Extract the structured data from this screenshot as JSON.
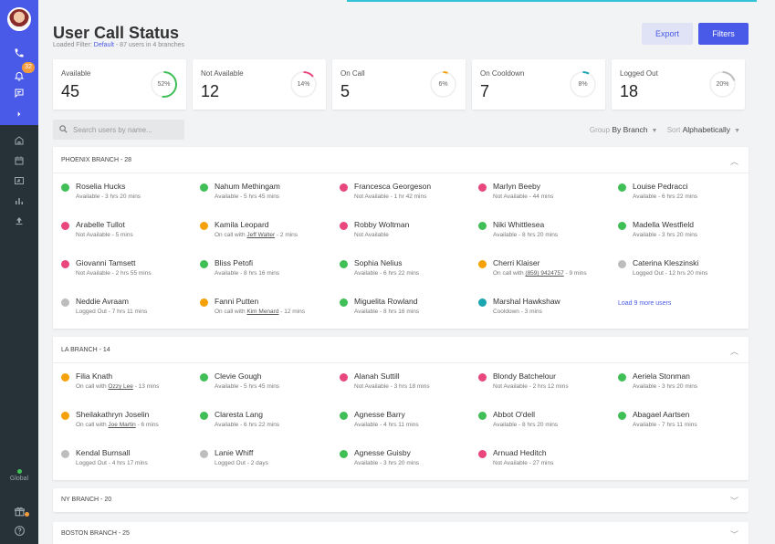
{
  "colors": {
    "available": "#3fbf55",
    "not_available": "#e8467c",
    "on_call": "#f5a10a",
    "cooldown": "#1aa6b0",
    "logged_out": "#bdbdbd",
    "accent": "#4a5ae8",
    "sidebar": "#263238"
  },
  "sidebar": {
    "icons": [
      "avatar",
      "phone-icon",
      "bell-icon",
      "chat-icon",
      "chevron-right-icon",
      "home-icon",
      "calendar-icon",
      "contact-card-icon",
      "bar-chart-icon",
      "upload-icon",
      "gift-icon",
      "help-icon"
    ],
    "notification_count": "32",
    "global_label": "Global"
  },
  "header": {
    "title": "User Call Status",
    "loaded_filter_label": "Loaded Filter:",
    "loaded_filter_value": "Default",
    "loaded_filter_summary": "- 87 users in 4 branches",
    "export_label": "Export",
    "filters_label": "Filters"
  },
  "stats": [
    {
      "label": "Available",
      "value": "45",
      "percent": 52,
      "percent_label": "52%",
      "color": "#3fbf55"
    },
    {
      "label": "Not Available",
      "value": "12",
      "percent": 14,
      "percent_label": "14%",
      "color": "#e8467c"
    },
    {
      "label": "On Call",
      "value": "5",
      "percent": 6,
      "percent_label": "6%",
      "color": "#f5a10a"
    },
    {
      "label": "On Cooldown",
      "value": "7",
      "percent": 8,
      "percent_label": "8%",
      "color": "#1aa6b0"
    },
    {
      "label": "Logged Out",
      "value": "18",
      "percent": 20,
      "percent_label": "20%",
      "color": "#bdbdbd"
    }
  ],
  "toolbar": {
    "search_placeholder": "Search users by name...",
    "group_label": "Group",
    "group_value": "By Branch",
    "sort_label": "Sort",
    "sort_value": "Alphabetically"
  },
  "branches": [
    {
      "title": "PHOENIX BRANCH - 28",
      "expanded": true,
      "load_more": "Load 9 more users",
      "users": [
        {
          "name": "Roselia Hucks",
          "status": "available",
          "pre": "Available - 3 hrs 20 mins",
          "link": "",
          "post": ""
        },
        {
          "name": "Nahum Methingam",
          "status": "available",
          "pre": "Available - 5 hrs 45 mins",
          "link": "",
          "post": ""
        },
        {
          "name": "Francesca Georgeson",
          "status": "not_available",
          "pre": "Not Available - 1 hr 42 mins",
          "link": "",
          "post": ""
        },
        {
          "name": "Marlyn Beeby",
          "status": "not_available",
          "pre": "Not Available - 44 mins",
          "link": "",
          "post": ""
        },
        {
          "name": "Louise Pedracci",
          "status": "available",
          "pre": "Available - 6 hrs 22 mins",
          "link": "",
          "post": ""
        },
        {
          "name": "Arabelle Tullot",
          "status": "not_available",
          "pre": "Not Available - 5 mins",
          "link": "",
          "post": ""
        },
        {
          "name": "Kamila Leopard",
          "status": "on_call",
          "pre": "On call with ",
          "link": "Jeff Walter",
          "post": " - 2 mins"
        },
        {
          "name": "Robby Woltman",
          "status": "not_available",
          "pre": "Not Available",
          "link": "",
          "post": ""
        },
        {
          "name": "Niki Whittlesea",
          "status": "available",
          "pre": "Available - 8 hrs 20 mins",
          "link": "",
          "post": ""
        },
        {
          "name": "Madella Westfield",
          "status": "available",
          "pre": "Available - 3 hrs 20 mins",
          "link": "",
          "post": ""
        },
        {
          "name": "Giovanni Tamsett",
          "status": "not_available",
          "pre": "Not Available - 2 hrs 55 mins",
          "link": "",
          "post": ""
        },
        {
          "name": "Bliss Petofi",
          "status": "available",
          "pre": "Available - 8 hrs 16 mins",
          "link": "",
          "post": ""
        },
        {
          "name": "Sophia Nelius",
          "status": "available",
          "pre": "Available - 6 hrs 22 mins",
          "link": "",
          "post": ""
        },
        {
          "name": "Cherri Klaiser",
          "status": "on_call",
          "pre": "On call with ",
          "link": "(859) 9424757",
          "post": " - 9 mins"
        },
        {
          "name": "Caterina Kleszinski",
          "status": "logged_out",
          "pre": "Logged Out - 12 hrs 20 mins",
          "link": "",
          "post": ""
        },
        {
          "name": "Neddie Avraam",
          "status": "logged_out",
          "pre": "Logged Out - 7 hrs 11 mins",
          "link": "",
          "post": ""
        },
        {
          "name": "Fanni Putten",
          "status": "on_call",
          "pre": "On call with ",
          "link": "Kim Menard",
          "post": " - 12 mins"
        },
        {
          "name": "Miguelita Rowland",
          "status": "available",
          "pre": "Available - 8 hrs 16 mins",
          "link": "",
          "post": ""
        },
        {
          "name": "Marshal Hawkshaw",
          "status": "cooldown",
          "pre": "Cooldown - 3 mins",
          "link": "",
          "post": ""
        }
      ]
    },
    {
      "title": "LA BRANCH - 14",
      "expanded": true,
      "load_more": "",
      "users": [
        {
          "name": "Filia Knath",
          "status": "on_call",
          "pre": "On call with ",
          "link": "Ozzy Lee",
          "post": " - 13 mins"
        },
        {
          "name": "Clevie Gough",
          "status": "available",
          "pre": "Available - 5 hrs 45 mins",
          "link": "",
          "post": ""
        },
        {
          "name": "Alanah Suttill",
          "status": "not_available",
          "pre": "Not Available - 3 hrs 18 mins",
          "link": "",
          "post": ""
        },
        {
          "name": "Blondy Batchelour",
          "status": "not_available",
          "pre": "Not Available - 2 hrs 12 mins",
          "link": "",
          "post": ""
        },
        {
          "name": "Aeriela Stonman",
          "status": "available",
          "pre": "Available - 3 hrs 20 mins",
          "link": "",
          "post": ""
        },
        {
          "name": "Sheilakathryn Joselin",
          "status": "on_call",
          "pre": "On call with ",
          "link": "Joe Martin",
          "post": " - 6 mins"
        },
        {
          "name": "Claresta Lang",
          "status": "available",
          "pre": "Available - 6 hrs 22 mins",
          "link": "",
          "post": ""
        },
        {
          "name": "Agnesse Barry",
          "status": "available",
          "pre": "Available - 4 hrs 11 mins",
          "link": "",
          "post": ""
        },
        {
          "name": "Abbot O'dell",
          "status": "available",
          "pre": "Available - 8 hrs 20 mins",
          "link": "",
          "post": ""
        },
        {
          "name": "Abagael Aartsen",
          "status": "available",
          "pre": "Available - 7 hrs 11 mins",
          "link": "",
          "post": ""
        },
        {
          "name": "Kendal Burnsall",
          "status": "logged_out",
          "pre": "Logged Out - 4 hrs 17 mins",
          "link": "",
          "post": ""
        },
        {
          "name": "Lanie Whiff",
          "status": "logged_out",
          "pre": "Logged Out - 2 days",
          "link": "",
          "post": ""
        },
        {
          "name": "Agnesse Guisby",
          "status": "available",
          "pre": "Available - 3 hrs 20 mins",
          "link": "",
          "post": ""
        },
        {
          "name": "Arnuad Heditch",
          "status": "not_available",
          "pre": "Not Available - 27 mins",
          "link": "",
          "post": ""
        }
      ]
    },
    {
      "title": "NY BRANCH - 20",
      "expanded": false,
      "load_more": "",
      "users": []
    },
    {
      "title": "BOSTON BRANCH - 25",
      "expanded": false,
      "load_more": "",
      "users": []
    }
  ]
}
